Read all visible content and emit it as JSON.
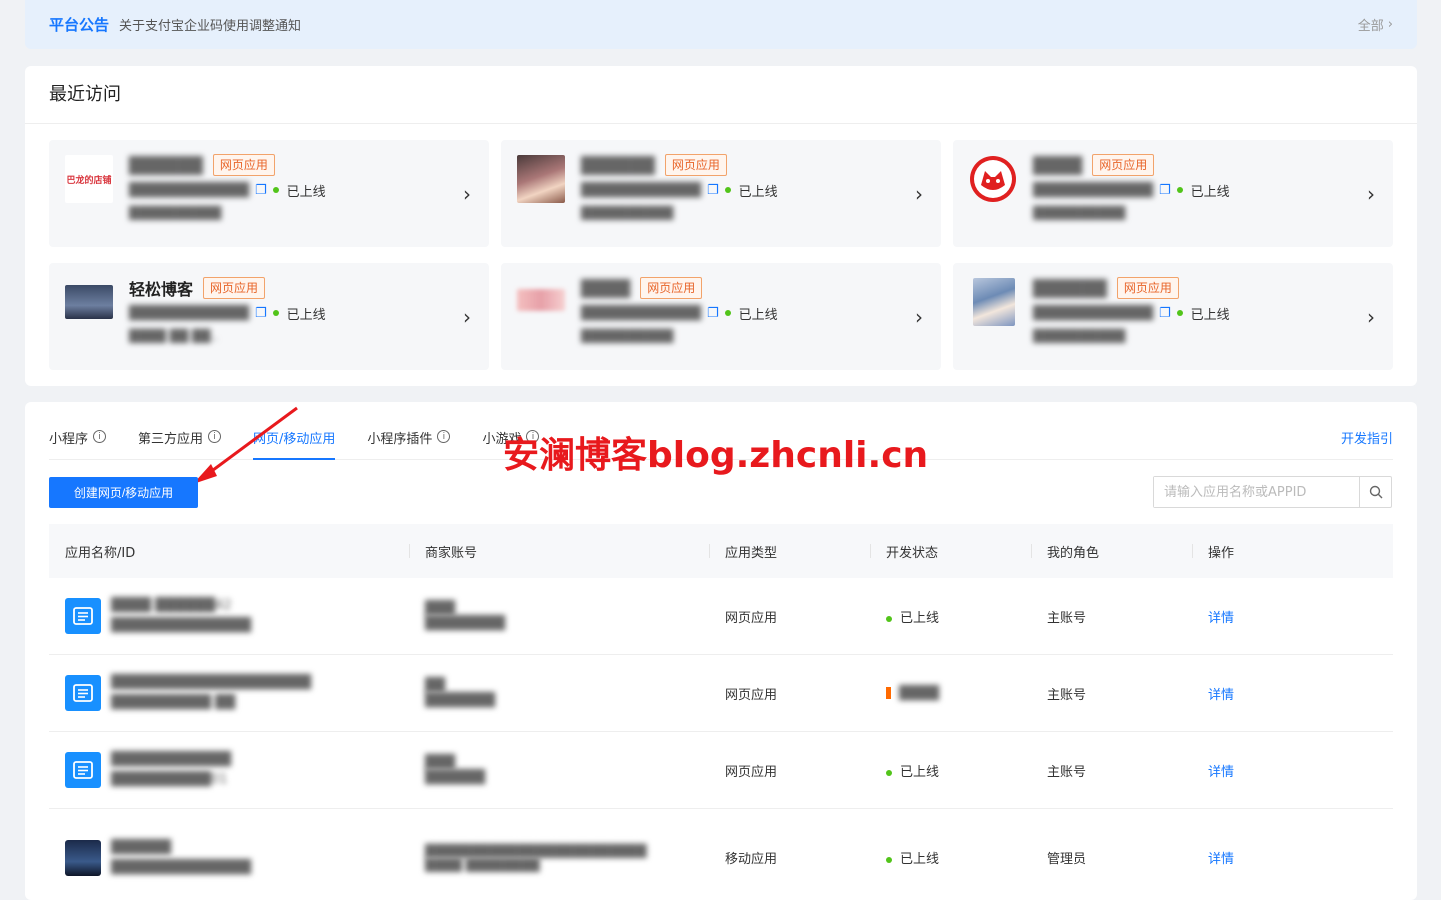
{
  "notice": {
    "title": "平台公告",
    "text": "关于支付宝企业码使用调整通知",
    "all": "全部"
  },
  "recent": {
    "title": "最近访问",
    "cards": [
      {
        "logo_text": "巴龙的店铺",
        "name": "██████",
        "tag": "网页应用",
        "id": "████████████",
        "status": "已上线",
        "extra": "██████████"
      },
      {
        "name": "██████",
        "tag": "网页应用",
        "id": "████████████",
        "status": "已上线",
        "extra": "██████████"
      },
      {
        "name": "████",
        "tag": "网页应用",
        "id": "████████████",
        "status": "已上线",
        "extra": "██████████"
      },
      {
        "name": "轻松博客",
        "tag": "网页应用",
        "id": "████████████",
        "status": "已上线",
        "extra": "████ ██ ██.."
      },
      {
        "name": "████",
        "tag": "网页应用",
        "id": "████████████",
        "status": "已上线",
        "extra": "██████████"
      },
      {
        "name": "██████",
        "tag": "网页应用",
        "id": "████████████",
        "status": "已上线",
        "extra": "██████████"
      }
    ]
  },
  "tabs": [
    {
      "label": "小程序",
      "info": true,
      "active": false
    },
    {
      "label": "第三方应用",
      "info": true,
      "active": false
    },
    {
      "label": "网页/移动应用",
      "info": false,
      "active": true
    },
    {
      "label": "小程序插件",
      "info": true,
      "active": false
    },
    {
      "label": "小游戏",
      "info": true,
      "active": false
    }
  ],
  "dev_guide": "开发指引",
  "watermark": "安澜博客blog.zhcnli.cn",
  "create_button": "创建网页/移动应用",
  "search": {
    "placeholder": "请输入应用名称或APPID"
  },
  "table": {
    "headers": [
      "应用名称/ID",
      "商家账号",
      "应用类型",
      "开发状态",
      "我的角色",
      "操作"
    ],
    "rows": [
      {
        "name": "████ ██████42",
        "id": "██████████████",
        "account1": "███",
        "account2": "████████",
        "type": "网页应用",
        "status": "已上线",
        "role": "主账号",
        "action": "详情"
      },
      {
        "name": "████████████████████",
        "id": "██████████ ██",
        "account1": "██",
        "account2": "███████",
        "type": "网页应用",
        "status": "████",
        "role": "主账号",
        "action": "详情"
      },
      {
        "name": "████████████",
        "id": "██████████01",
        "account1": "███",
        "account2": "██████",
        "type": "网页应用",
        "status": "已上线",
        "role": "主账号",
        "action": "详情"
      },
      {
        "name": "██████",
        "id": "██████████████",
        "account1": "████████████████████████",
        "account2": "████ ████████",
        "type": "移动应用",
        "status": "已上线",
        "role": "管理员",
        "action": "详情"
      }
    ]
  },
  "colors": {
    "primary": "#1677ff",
    "online": "#52c41a",
    "tag": "#e8652a",
    "watermark": "#e8191d"
  }
}
